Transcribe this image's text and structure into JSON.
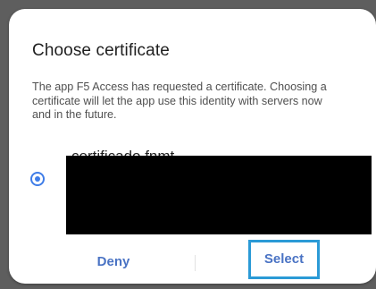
{
  "dialog": {
    "title": "Choose certificate",
    "description": "The app F5 Access has requested a certificate. Choosing a certificate will let the app use this identity with servers now and in the future.",
    "certificate": {
      "name": "certificado fnmt",
      "selected": true
    },
    "buttons": {
      "deny_label": "Deny",
      "select_label": "Select"
    }
  },
  "colors": {
    "accent": "#3f7de8",
    "button_text": "#4a73c4",
    "highlight_box": "#2b9ad6"
  }
}
